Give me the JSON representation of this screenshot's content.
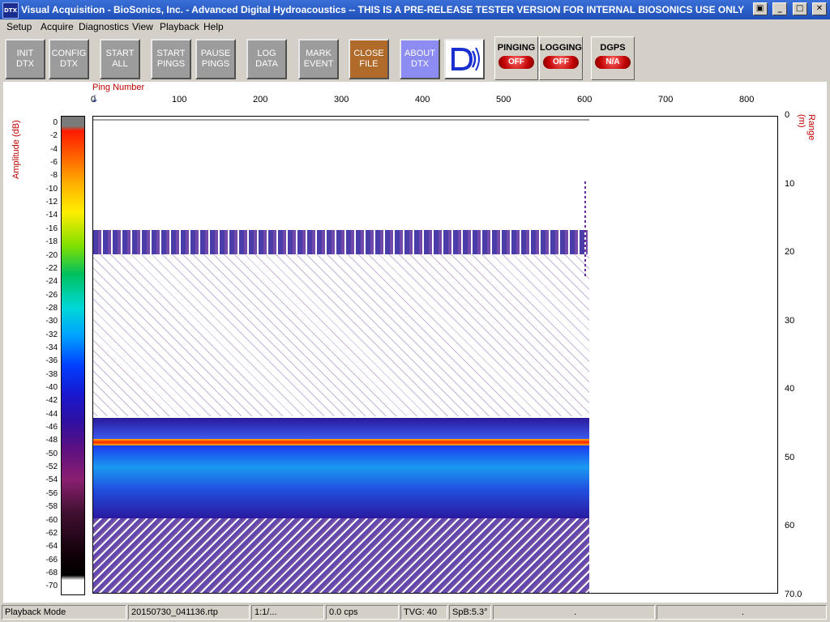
{
  "window": {
    "title": "Visual Acquisition  -  BioSonics, Inc.  -  Advanced Digital Hydroacoustics  -- THIS IS A PRE-RELEASE TESTER VERSION FOR INTERNAL BIOSONICS USE ONLY",
    "app_icon_text": "DTX"
  },
  "menu": [
    "Setup",
    "Acquire",
    "Diagnostics",
    "View",
    "Playback",
    "Help"
  ],
  "toolbar": {
    "buttons": [
      {
        "label": "INIT\nDTX"
      },
      {
        "label": "CONFIG\nDTX"
      },
      {
        "label": "START\nALL"
      },
      {
        "label": "START\nPINGS"
      },
      {
        "label": "PAUSE\nPINGS"
      },
      {
        "label": "LOG\nDATA"
      },
      {
        "label": "MARK\nEVENT"
      },
      {
        "label": "CLOSE\nFILE"
      },
      {
        "label": "ABOUT\nDTX"
      }
    ],
    "status": [
      {
        "title": "PINGING",
        "value": "OFF"
      },
      {
        "title": "LOGGING",
        "value": "OFF"
      },
      {
        "title": "DGPS",
        "value": "N/A"
      }
    ]
  },
  "echogram": {
    "x_axis_title": "Ping Number",
    "x_ticks": [
      "0",
      "100",
      "200",
      "300",
      "400",
      "500",
      "600",
      "700",
      "800"
    ],
    "y_axis_title": "Range (m)",
    "y_ticks": [
      "0",
      "10",
      "20",
      "30",
      "40",
      "50",
      "60",
      "70.0"
    ],
    "amplitude_title": "Amplitude (dB)",
    "amplitude_ticks": [
      "0",
      "-2",
      "-4",
      "-6",
      "-8",
      "-10",
      "-12",
      "-14",
      "-16",
      "-18",
      "-20",
      "-22",
      "-24",
      "-26",
      "-28",
      "-30",
      "-32",
      "-34",
      "-36",
      "-38",
      "-40",
      "-42",
      "-44",
      "-46",
      "-48",
      "-50",
      "-52",
      "-54",
      "-56",
      "-58",
      "-60",
      "-62",
      "-64",
      "-66",
      "-68",
      "-70"
    ]
  },
  "statusbar": {
    "mode": "Playback Mode",
    "file": "20150730_041136.rtp",
    "ratio": "1:1/...",
    "cps": "0.0 cps",
    "tvg": "TVG: 40",
    "spb": "SpB:5.3°",
    "dot1": ".",
    "dot2": "."
  }
}
